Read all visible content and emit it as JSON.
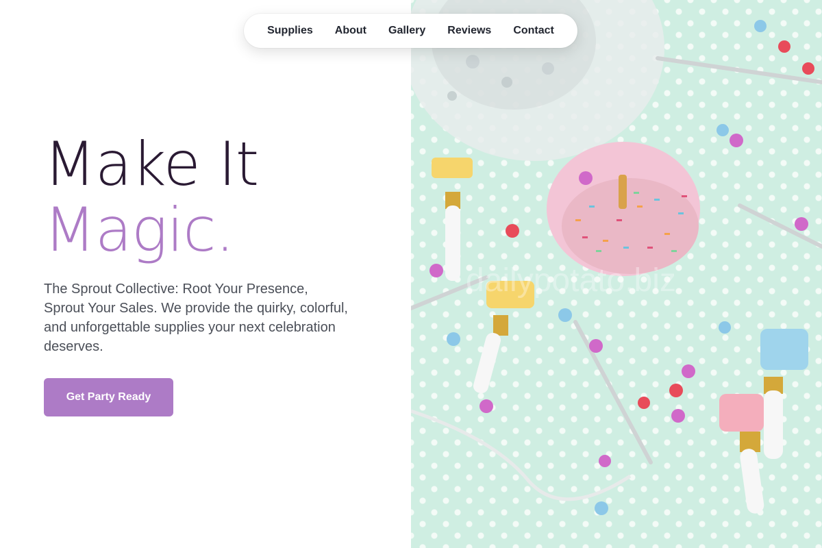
{
  "nav": {
    "items": [
      {
        "label": "Supplies"
      },
      {
        "label": "About"
      },
      {
        "label": "Gallery"
      },
      {
        "label": "Reviews"
      },
      {
        "label": "Contact"
      }
    ]
  },
  "hero": {
    "headline_line1": "Make It",
    "headline_line2": "Magic.",
    "tagline": "The Sprout Collective: Root Your Presence, Sprout Your Sales. We provide the quirky, colorful, and unforgettable supplies your next celebration deserves.",
    "cta_label": "Get Party Ready",
    "image_alt": "Party supplies with pink sprinkled donut, confetti and party blowers",
    "watermark": "dailypotato.biz"
  },
  "colors": {
    "accent": "#ad7bc6",
    "heading": "#2a1a33",
    "body_text": "#4b4f58",
    "photo_background": "#cfeee2"
  }
}
